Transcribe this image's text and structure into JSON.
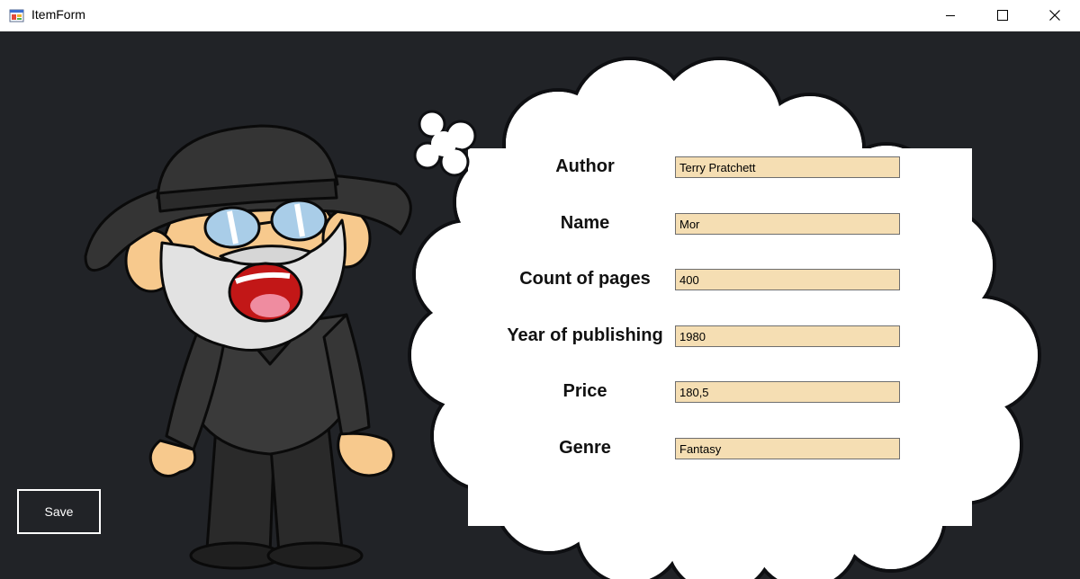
{
  "window": {
    "title": "ItemForm",
    "icons": {
      "app": "app-form-icon",
      "minimize": "minimize-icon",
      "maximize": "maximize-icon",
      "close": "close-icon"
    }
  },
  "colors": {
    "background": "#212327",
    "input_background": "#f5deb3",
    "cloud": "#ffffff",
    "save_border": "#ffffff"
  },
  "form": {
    "fields": [
      {
        "label": "Author",
        "value": "Terry Pratchett"
      },
      {
        "label": "Name",
        "value": "Mor"
      },
      {
        "label": "Count of pages",
        "value": "400"
      },
      {
        "label": "Year of publishing",
        "value": "1980"
      },
      {
        "label": "Price",
        "value": "180,5"
      },
      {
        "label": "Genre",
        "value": "Fantasy"
      }
    ]
  },
  "save_button": {
    "label": "Save"
  }
}
